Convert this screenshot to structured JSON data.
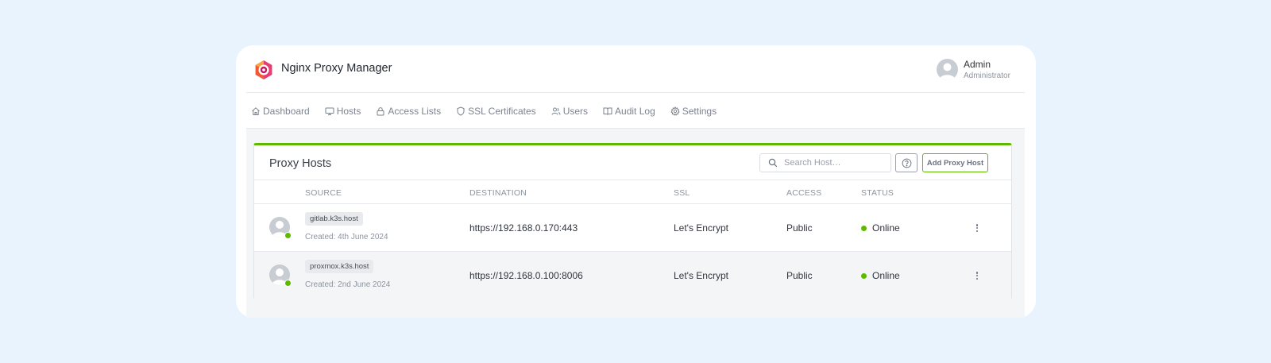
{
  "app": {
    "title": "Nginx Proxy Manager"
  },
  "user": {
    "name": "Admin",
    "role": "Administrator"
  },
  "nav": [
    {
      "label": "Dashboard",
      "icon": "home-icon"
    },
    {
      "label": "Hosts",
      "icon": "monitor-icon"
    },
    {
      "label": "Access Lists",
      "icon": "lock-icon"
    },
    {
      "label": "SSL Certificates",
      "icon": "shield-icon"
    },
    {
      "label": "Users",
      "icon": "users-icon"
    },
    {
      "label": "Audit Log",
      "icon": "book-icon"
    },
    {
      "label": "Settings",
      "icon": "gear-icon"
    }
  ],
  "panel": {
    "title": "Proxy Hosts",
    "search_placeholder": "Search Host…",
    "add_label": "Add Proxy Host"
  },
  "table": {
    "headers": {
      "source": "SOURCE",
      "destination": "DESTINATION",
      "ssl": "SSL",
      "access": "ACCESS",
      "status": "STATUS"
    },
    "rows": [
      {
        "host": "gitlab.k3s.host",
        "created": "Created: 4th June 2024",
        "destination": "https://192.168.0.170:443",
        "ssl": "Let's Encrypt",
        "access": "Public",
        "status": "Online"
      },
      {
        "host": "proxmox.k3s.host",
        "created": "Created: 2nd June 2024",
        "destination": "https://192.168.0.100:8006",
        "ssl": "Let's Encrypt",
        "access": "Public",
        "status": "Online"
      }
    ]
  },
  "colors": {
    "accent": "#5eba00",
    "background": "#e9f3fd",
    "logo": "#f15833"
  }
}
